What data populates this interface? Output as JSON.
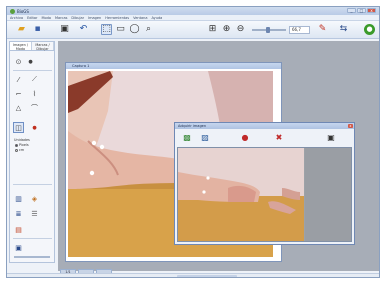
{
  "app": {
    "title": "BioGS",
    "window_buttons": [
      "_",
      "□",
      "x"
    ]
  },
  "menubar": {
    "items": [
      "Archivo",
      "Editar",
      "Modo",
      "Marcas",
      "Dibujar",
      "Imagen",
      "Herramientas",
      "Ventana",
      "Ayuda"
    ]
  },
  "toolbar": {
    "icons": [
      "open-folder-icon",
      "save-icon",
      "video-icon",
      "undo-icon",
      "select-icon",
      "rectangle-select-icon",
      "circle-select-icon",
      "zoom-tool-icon",
      "fit-icon",
      "zoom-in-icon",
      "zoom-out-icon",
      "edit-icon",
      "export-icon",
      "run-icon"
    ],
    "zoom_value": "66,7"
  },
  "side_panel": {
    "tabs": [
      "Imagen / Modo",
      "Marcas / Dibujar"
    ],
    "section_label": "Unidades",
    "radio_options": [
      "Pixels",
      "cm"
    ],
    "selected_radio": "Pixels"
  },
  "document": {
    "title": "Captura 1"
  },
  "dialog": {
    "title": "Adquirir imagen",
    "close_label": "x"
  },
  "bottom_tabs": [
    "1/1",
    "",
    ""
  ]
}
